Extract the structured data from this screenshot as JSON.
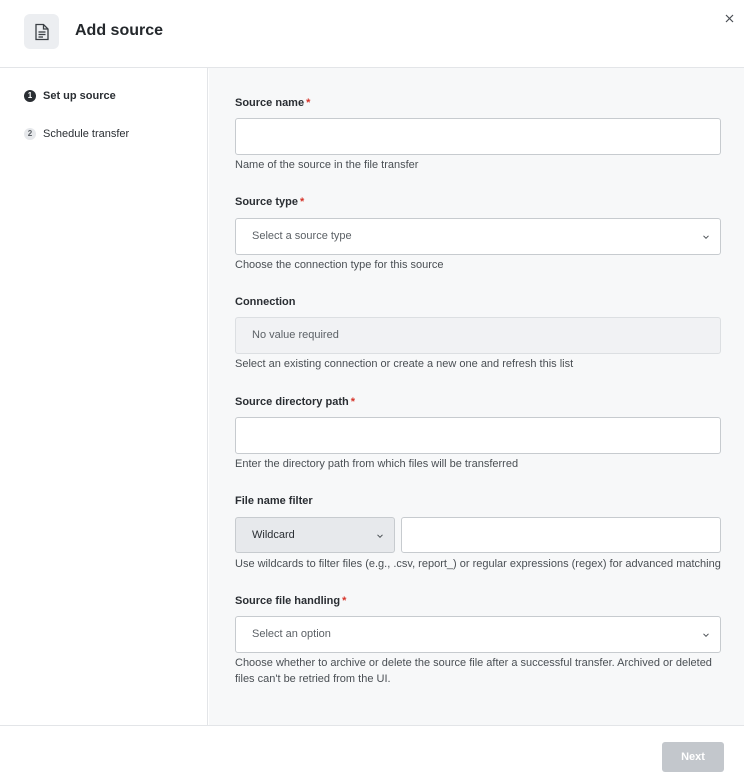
{
  "header": {
    "title": "Add source",
    "icon": "document-icon",
    "close_icon": "close-icon"
  },
  "steps": [
    {
      "number": "1",
      "label": "Set up source",
      "active": true
    },
    {
      "number": "2",
      "label": "Schedule transfer",
      "active": false
    }
  ],
  "form": {
    "source_name": {
      "label": "Source name",
      "required_marker": "*",
      "value": "",
      "helper": "Name of the source in the file transfer"
    },
    "source_type": {
      "label": "Source type",
      "required_marker": "*",
      "placeholder": "Select a source type",
      "helper": "Choose the connection type for this source"
    },
    "connection": {
      "label": "Connection",
      "value": "No value required",
      "helper": "Select an existing connection or create a new one and refresh this list"
    },
    "source_directory_path": {
      "label": "Source directory path",
      "required_marker": "*",
      "value": "",
      "helper": "Enter the directory path from which files will be transferred"
    },
    "file_name_filter": {
      "label": "File name filter",
      "mode": "Wildcard",
      "value": "",
      "helper": "Use wildcards to filter files (e.g., .csv, report_) or regular expressions (regex) for advanced matching"
    },
    "source_file_handling": {
      "label": "Source file handling",
      "required_marker": "*",
      "placeholder": "Select an option",
      "helper": "Choose whether to archive or delete the source file after a successful transfer. Archived or deleted files can't be retried from the UI."
    }
  },
  "footer": {
    "next_label": "Next"
  },
  "colors": {
    "required": "#d6342a",
    "disabled_button": "#c3c7cc",
    "active_step": "#2a2e33"
  }
}
